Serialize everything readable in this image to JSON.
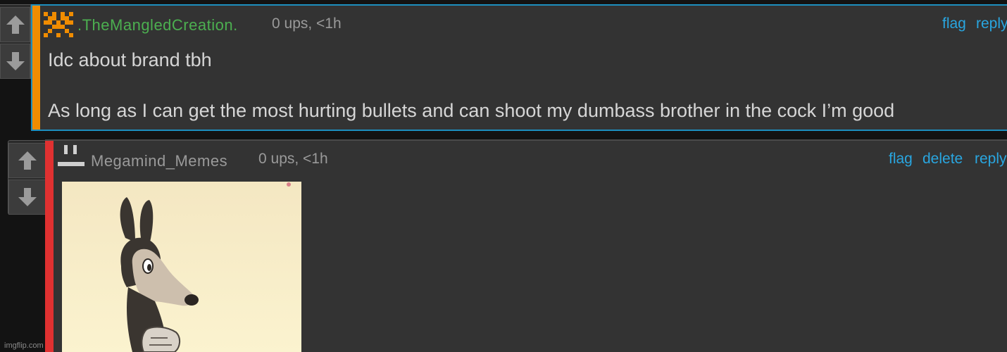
{
  "comments": [
    {
      "username": ".TheMangledCreation.",
      "meta": "0 ups, <1h",
      "actions": [
        "flag",
        "reply"
      ],
      "body_lines": [
        "Idc about brand tbh",
        "As long as I can get the most hurting bullets and can shoot my dumbass brother in the cock I’m good"
      ],
      "accent_color": "#f08c00",
      "username_color": "#4caf50"
    },
    {
      "username": "Megamind_Memes",
      "meta": "0 ups, <1h",
      "actions": [
        "flag",
        "delete",
        "reply"
      ],
      "accent_color": "#e03131",
      "username_color": "#9a9a9a",
      "image_icon": "cartoon-dog-image"
    }
  ],
  "watermark": "imgflip.com"
}
